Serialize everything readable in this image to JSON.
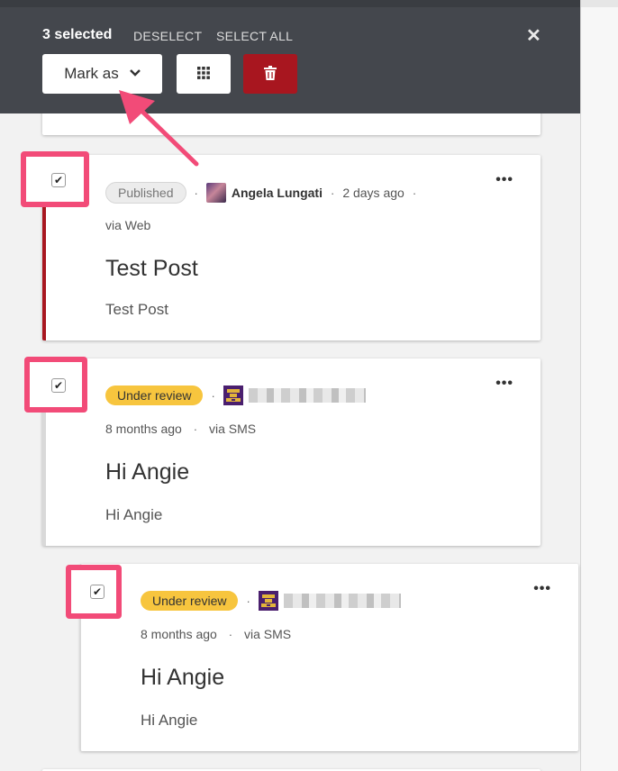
{
  "selection": {
    "count_label": "3 selected",
    "deselect_label": "DESELECT",
    "select_all_label": "SELECT ALL",
    "mark_as_label": "Mark as"
  },
  "posts": [
    {
      "status": "Published",
      "author": "Angela Lungati",
      "time": "2 days ago",
      "source": "via Web",
      "title": "Test Post",
      "body": "Test Post",
      "checked": true
    },
    {
      "status": "Under review",
      "author": "",
      "time": "8 months ago",
      "source": "via SMS",
      "title": "Hi Angie",
      "body": "Hi Angie",
      "checked": true
    },
    {
      "status": "Under review",
      "author": "",
      "time": "8 months ago",
      "source": "via SMS",
      "title": "Hi Angie",
      "body": "Hi Angie",
      "checked": true
    }
  ],
  "more_label": "•••",
  "colors": {
    "toolbar_bg": "#44474d",
    "delete_button": "#a8161f",
    "published_accent": "#a8161f",
    "review_badge": "#f7c53e",
    "highlight": "#f24b78"
  },
  "icons": {
    "close": "close-icon",
    "chevron": "chevron-down-icon",
    "grid": "grid-icon",
    "delete": "trash-icon",
    "check": "checkmark-icon"
  }
}
